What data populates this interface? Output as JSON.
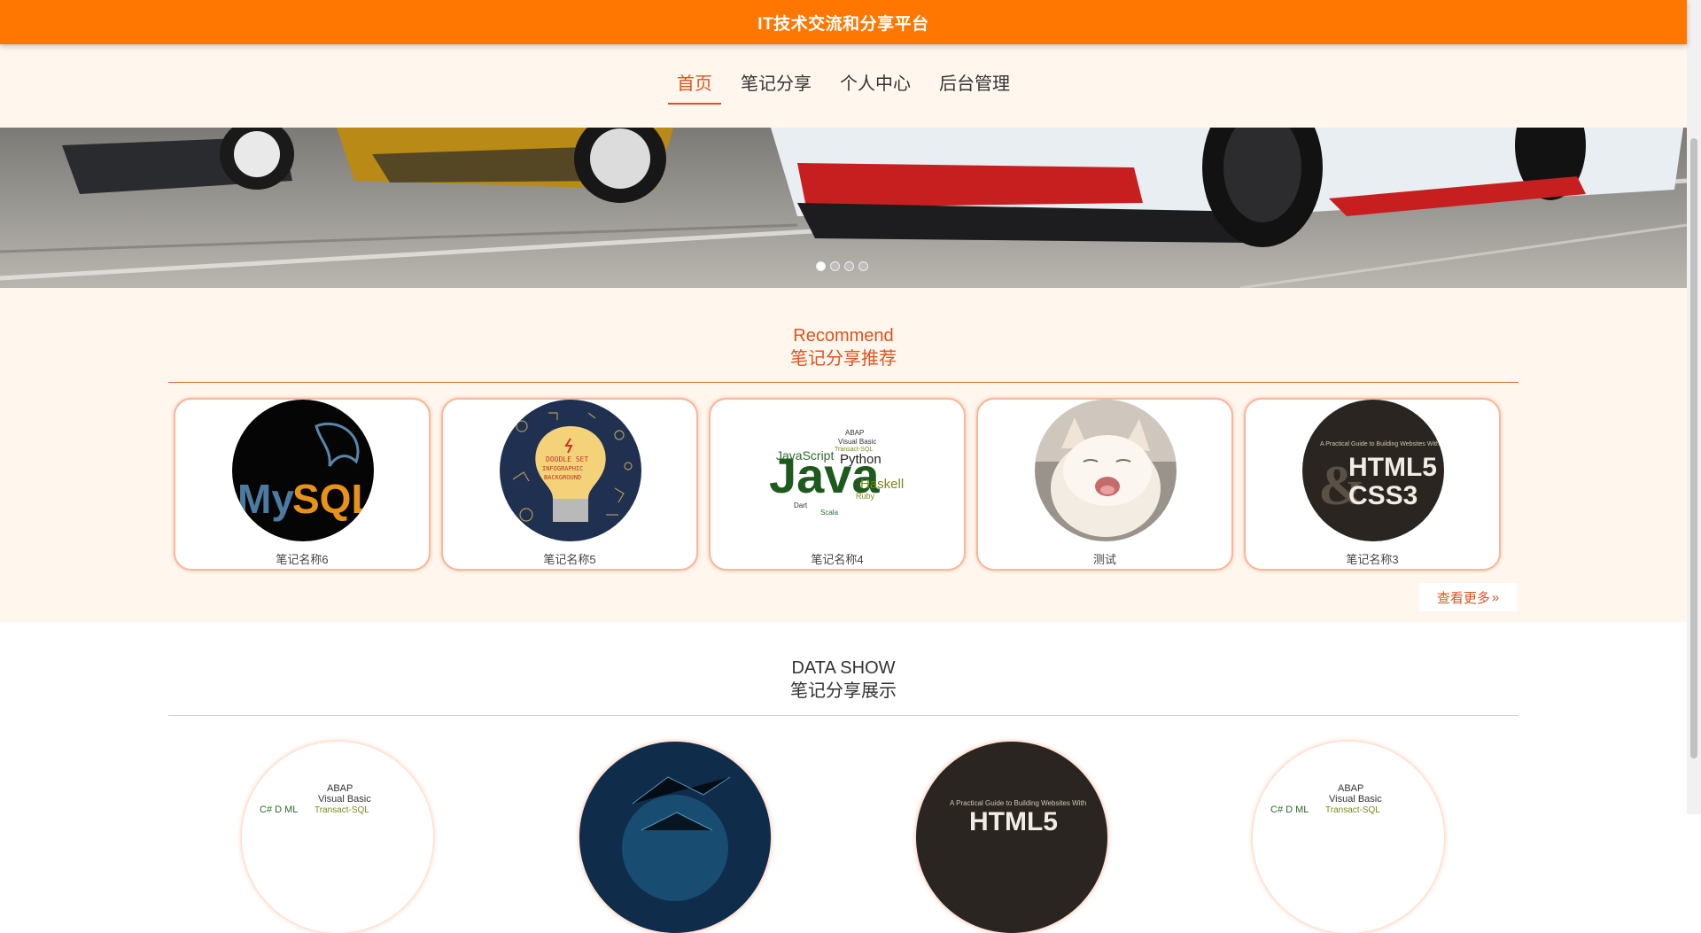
{
  "header": {
    "title": "IT技术交流和分享平台"
  },
  "nav": {
    "items": [
      {
        "label": "首页",
        "active": true
      },
      {
        "label": "笔记分享",
        "active": false
      },
      {
        "label": "个人中心",
        "active": false
      },
      {
        "label": "后台管理",
        "active": false
      }
    ]
  },
  "banner": {
    "slide_count": 4,
    "active_index": 0
  },
  "recommend": {
    "title_en": "Recommend",
    "title_cn": "笔记分享推荐",
    "cards": [
      {
        "caption": "笔记名称6",
        "image": "mysql-logo"
      },
      {
        "caption": "笔记名称5",
        "image": "lightbulb-doodle"
      },
      {
        "caption": "笔记名称4",
        "image": "java-wordcloud"
      },
      {
        "caption": "测试",
        "image": "yawning-cat"
      },
      {
        "caption": "笔记名称3",
        "image": "html5-css3-book"
      }
    ],
    "more_label": "查看更多"
  },
  "datashow": {
    "title_en": "DATA SHOW",
    "title_cn": "笔记分享展示"
  },
  "colors": {
    "accent": "#ff7700",
    "section_text": "#e0531d",
    "section_bg": "#fff6ee"
  }
}
